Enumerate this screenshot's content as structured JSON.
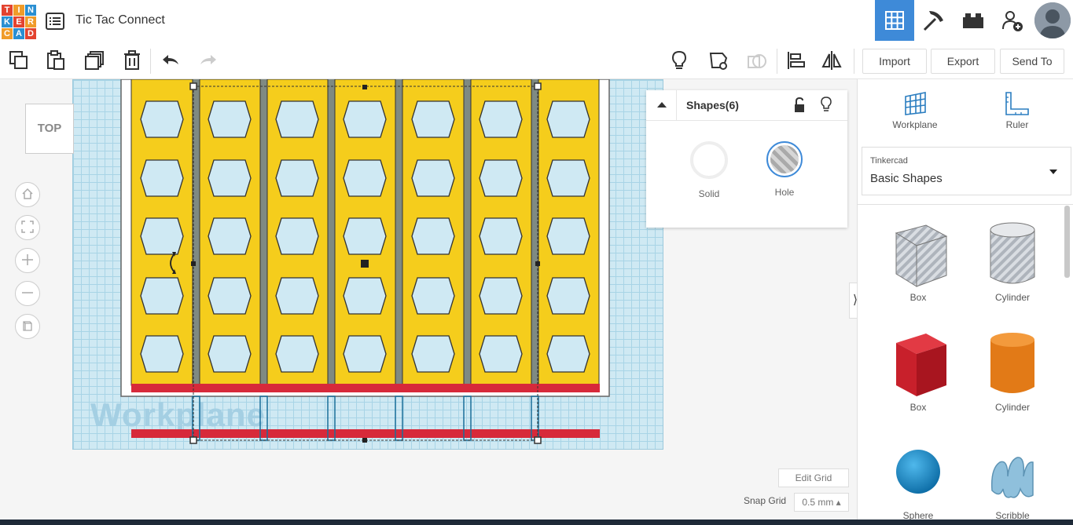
{
  "app": {
    "logo_letters": [
      "T",
      "I",
      "N",
      "K",
      "E",
      "R",
      "C",
      "A",
      "D"
    ],
    "logo_colors": [
      "#e3432f",
      "#f09c2a",
      "#2a8fd2",
      "#2a8fd2",
      "#e3432f",
      "#f09c2a",
      "#f09c2a",
      "#2a8fd2",
      "#e3432f"
    ],
    "title": "Tic Tac Connect"
  },
  "toolbar": {
    "import_label": "Import",
    "export_label": "Export",
    "send_to_label": "Send To"
  },
  "canvas": {
    "view_label": "TOP",
    "workplane_label": "Workplane",
    "edit_grid_label": "Edit Grid",
    "snap_grid_label": "Snap Grid",
    "snap_grid_value": "0.5 mm ▴",
    "colors": {
      "panel": "#f5cd1c",
      "gap": "#7f8a82",
      "bar": "#d7293a",
      "grid": "#cfe9f3"
    }
  },
  "shapes_panel": {
    "title": "Shapes(6)",
    "solid_label": "Solid",
    "hole_label": "Hole"
  },
  "right_panel": {
    "workplane_label": "Workplane",
    "ruler_label": "Ruler",
    "library_source": "Tinkercad",
    "library_name": "Basic Shapes",
    "shapes": [
      {
        "label": "Box",
        "icon": "box-hole-icon"
      },
      {
        "label": "Cylinder",
        "icon": "cylinder-hole-icon"
      },
      {
        "label": "Box",
        "icon": "box-icon",
        "color": "#c8202b"
      },
      {
        "label": "Cylinder",
        "icon": "cylinder-icon",
        "color": "#e27a17"
      },
      {
        "label": "Sphere",
        "icon": "sphere-icon",
        "color": "#1a8fd0"
      },
      {
        "label": "Scribble",
        "icon": "scribble-icon",
        "color": "#7fb3d0"
      }
    ]
  }
}
